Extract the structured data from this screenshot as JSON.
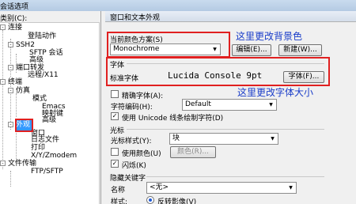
{
  "window": {
    "title": "会话选项"
  },
  "tree": {
    "category_label": "类别(C):",
    "items": [
      {
        "label": "连接",
        "exp": "-"
      },
      {
        "label": "登陆动作"
      },
      {
        "label": "SSH2",
        "exp": "-"
      },
      {
        "label": "SFTP 会话"
      },
      {
        "label": "高级"
      },
      {
        "label": "端口转发",
        "exp": "-"
      },
      {
        "label": "远程/X11"
      },
      {
        "label": "终端",
        "exp": "-"
      },
      {
        "label": "仿真",
        "exp": "-"
      },
      {
        "label": "模式"
      },
      {
        "label": "Emacs"
      },
      {
        "label": "映射键"
      },
      {
        "label": "高级"
      },
      {
        "label": "外观",
        "exp": "-"
      },
      {
        "label": "窗口"
      },
      {
        "label": "日志文件"
      },
      {
        "label": "打印"
      },
      {
        "label": "X/Y/Zmodem"
      },
      {
        "label": "文件传输",
        "exp": "-"
      },
      {
        "label": "FTP/SFTP"
      }
    ]
  },
  "panel": {
    "header": "窗口和文本外观",
    "color_scheme": {
      "label": "当前颜色方案(S)",
      "value": "Monochrome",
      "edit_button": "编辑(E)...",
      "new_button": "新建(W)..."
    },
    "font": {
      "group_label": "字体",
      "standard_label": "标准字体",
      "value": "Lucida Console 9pt",
      "font_button": "字体(F)..."
    },
    "precise_font": {
      "label": "精确字体(A):",
      "checked": false
    },
    "encoding": {
      "label": "字符编码(H):",
      "value": "Default"
    },
    "unicode_line": {
      "label": "使用 Unicode 线条绘制字符(D)",
      "checked": true
    },
    "cursor": {
      "group_label": "光标",
      "style_label": "光标样式(Y):",
      "style_value": "块",
      "use_color_label": "使用颜色(U)",
      "use_color_checked": false,
      "color_button": "颜色(R)...",
      "blink_label": "闪烁(K)",
      "blink_checked": true
    },
    "hidden_keywords": {
      "group_label": "隐藏关键字",
      "name_label": "名称",
      "name_value": "<无>",
      "style_label": "样式:",
      "style_option": "反转影像(V)"
    }
  },
  "annotations": {
    "background_note": "这里更改背景色",
    "font_note": "这里更改字体大小"
  },
  "colors": {
    "annotation": "#1a3dc9",
    "highlight_box": "#e02020",
    "selection": "#3399ff"
  }
}
